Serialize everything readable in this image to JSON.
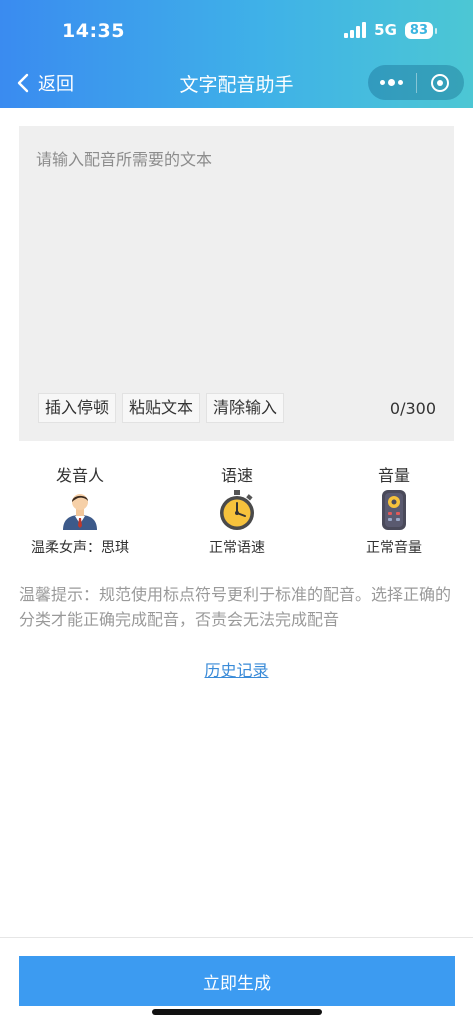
{
  "status_bar": {
    "time": "14:35",
    "network": "5G",
    "battery": "83"
  },
  "nav": {
    "back_label": "返回",
    "title": "文字配音助手"
  },
  "editor": {
    "placeholder": "请输入配音所需要的文本",
    "value": "",
    "tools": [
      "插入停顿",
      "粘贴文本",
      "清除输入"
    ],
    "char_count": "0/300"
  },
  "options": {
    "speaker": {
      "title": "发音人",
      "value": "温柔女声：思琪",
      "icon": "person-icon"
    },
    "speed": {
      "title": "语速",
      "value": "正常语速",
      "icon": "stopwatch-icon"
    },
    "volume": {
      "title": "音量",
      "value": "正常音量",
      "icon": "remote-control-icon"
    }
  },
  "tip": "温馨提示：规范使用标点符号更利于标准的配音。选择正确的分类才能正确完成配音，否责会无法完成配音",
  "history_link": "历史记录",
  "generate_button": "立即生成",
  "colors": {
    "accent": "#3c9bf1",
    "header_start": "#3a8bf0",
    "header_end": "#4cc7d4",
    "link": "#3a8bd8"
  }
}
